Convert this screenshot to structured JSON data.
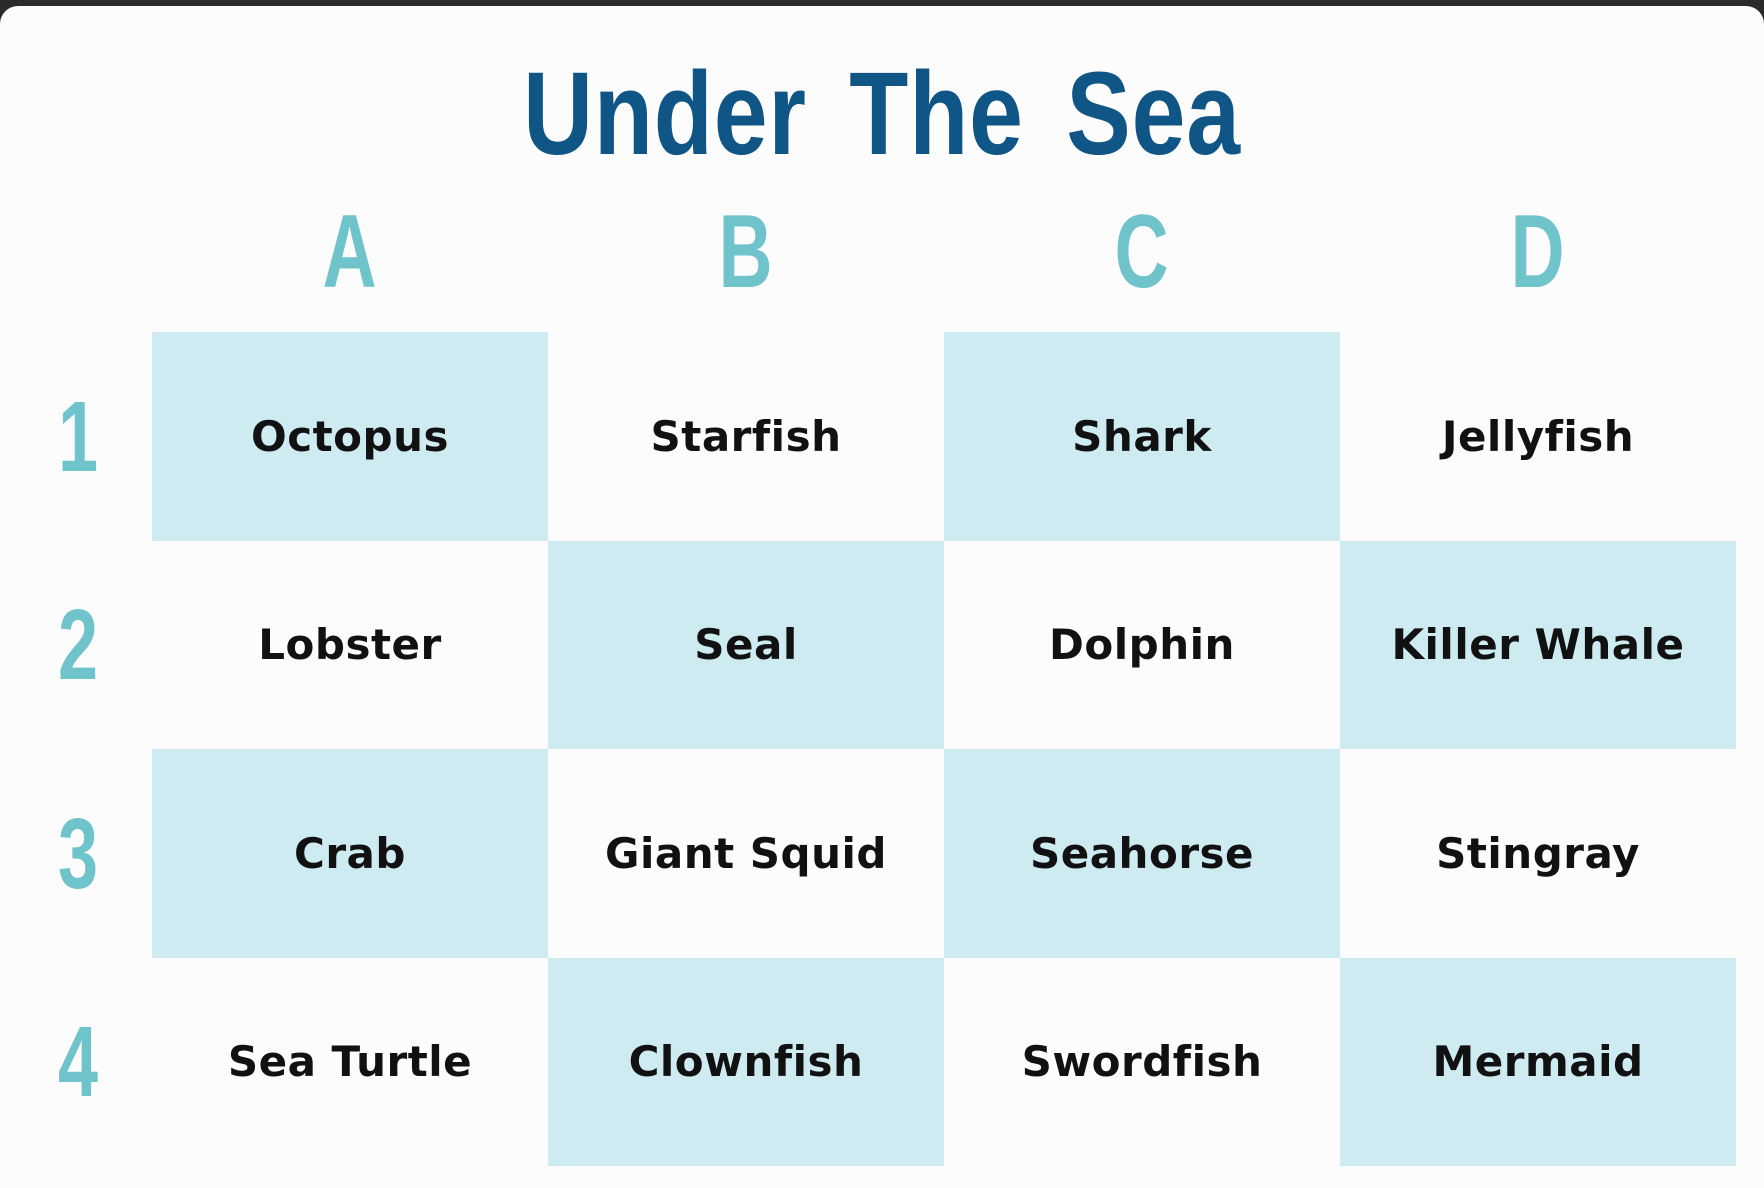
{
  "title": "Under The Sea",
  "columns": [
    "A",
    "B",
    "C",
    "D"
  ],
  "rows": [
    "1",
    "2",
    "3",
    "4"
  ],
  "colors": {
    "title": "#0f5585",
    "header": "#6fc4cc",
    "shaded_cell": "#cdebf1",
    "cell_text": "#111111"
  },
  "cells": [
    [
      "Octopus",
      "Starfish",
      "Shark",
      "Jellyfish"
    ],
    [
      "Lobster",
      "Seal",
      "Dolphin",
      "Killer Whale"
    ],
    [
      "Crab",
      "Giant Squid",
      "Seahorse",
      "Stingray"
    ],
    [
      "Sea Turtle",
      "Clownfish",
      "Swordfish",
      "Mermaid"
    ]
  ]
}
